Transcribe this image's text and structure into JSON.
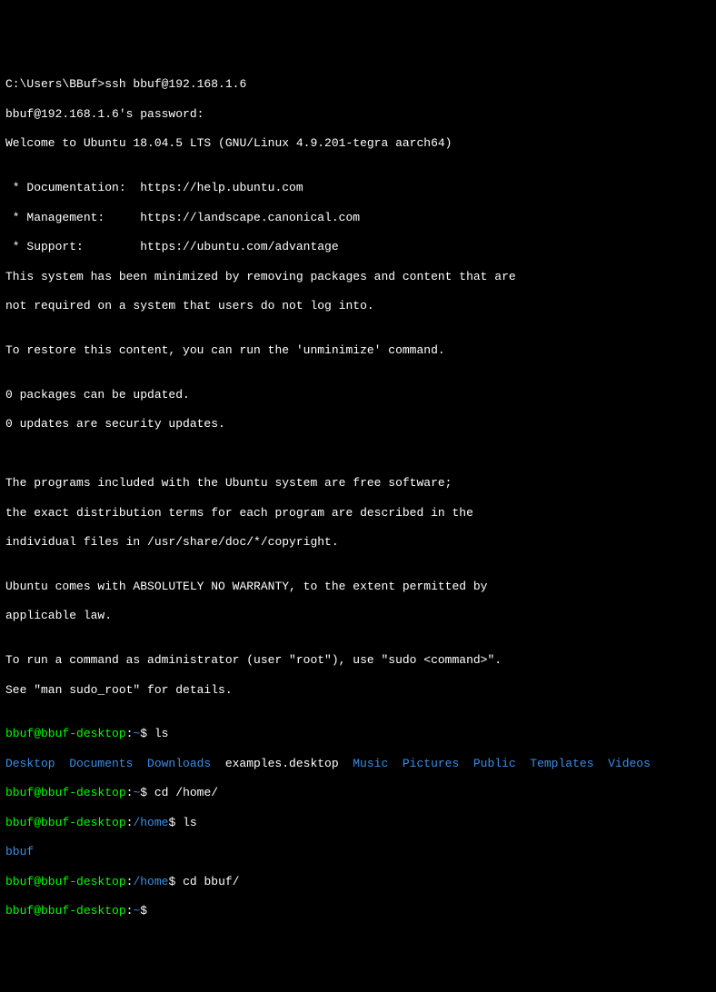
{
  "lines": {
    "l0": "C:\\Users\\BBuf>ssh bbuf@192.168.1.6",
    "l1": "bbuf@192.168.1.6's password:",
    "l2": "Welcome to Ubuntu 18.04.5 LTS (GNU/Linux 4.9.201-tegra aarch64)",
    "l3": "",
    "l4": " * Documentation:  https://help.ubuntu.com",
    "l5": " * Management:     https://landscape.canonical.com",
    "l6": " * Support:        https://ubuntu.com/advantage",
    "l7": "This system has been minimized by removing packages and content that are",
    "l8": "not required on a system that users do not log into.",
    "l9": "",
    "l10": "To restore this content, you can run the 'unminimize' command.",
    "l11": "",
    "l12": "0 packages can be updated.",
    "l13": "0 updates are security updates.",
    "l14": "",
    "l15": "",
    "l16": "The programs included with the Ubuntu system are free software;",
    "l17": "the exact distribution terms for each program are described in the",
    "l18": "individual files in /usr/share/doc/*/copyright.",
    "l19": "",
    "l20": "Ubuntu comes with ABSOLUTELY NO WARRANTY, to the extent permitted by",
    "l21": "applicable law.",
    "l22": "",
    "l23": "To run a command as administrator (user \"root\"), use \"sudo <command>\".",
    "l24": "See \"man sudo_root\" for details.",
    "l25": ""
  },
  "prompt": {
    "userhost": "bbuf@bbuf-desktop",
    "colon": ":",
    "home": "~",
    "homepath": "/home",
    "dollar": "$ ",
    "cmd_ls": "ls",
    "cmd_cd_home": "cd /home/",
    "cmd_cd_bbuf": "cd bbuf/"
  },
  "ls": {
    "desktop": "Desktop",
    "documents": "Documents",
    "downloads": "Downloads",
    "examples": "examples.desktop",
    "music": "Music",
    "pictures": "Pictures",
    "public": "Public",
    "templates": "Templates",
    "videos": "Videos"
  },
  "ls2": {
    "bbuf": "bbuf"
  }
}
